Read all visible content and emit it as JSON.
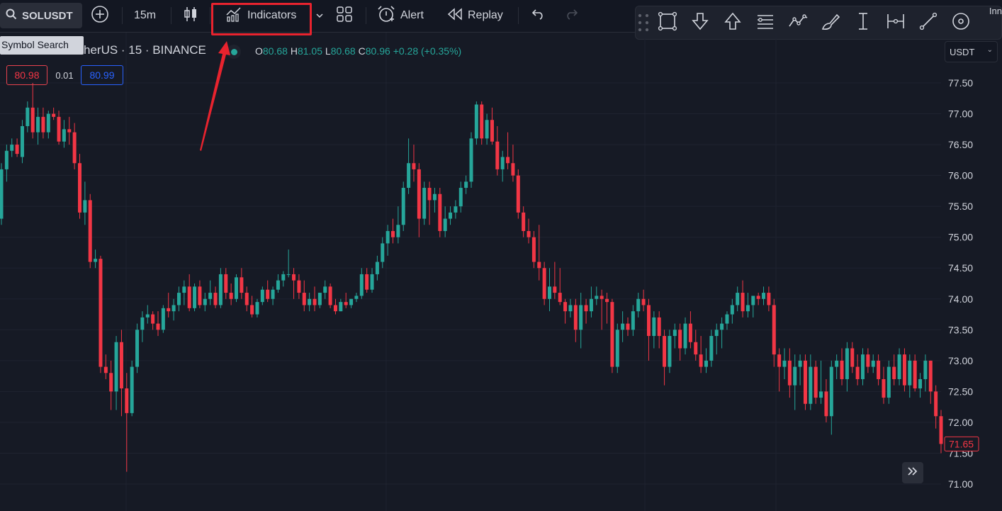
{
  "toolbar": {
    "symbol": "SOLUSDT",
    "interval": "15m",
    "indicators_label": "Indicators",
    "alert_label": "Alert",
    "replay_label": "Replay"
  },
  "tooltip": {
    "text": "Symbol Search"
  },
  "legend": {
    "symbol_text": "herUS · 15 · BINANCE",
    "o_key": "O",
    "o_val": "80.68",
    "h_key": "H",
    "h_val": "81.05",
    "l_key": "L",
    "l_val": "80.68",
    "c_key": "C",
    "c_val": "80.96",
    "change": "+0.28 (+0.35%)"
  },
  "order": {
    "sell": "80.98",
    "spread": "0.01",
    "buy": "80.99"
  },
  "currency": {
    "value": "USDT"
  },
  "drawbar": {
    "edge_text": "Inn"
  },
  "colors": {
    "up": "#26a69a",
    "down": "#f23645",
    "accent": "#2962ff",
    "highlight": "#e8232e"
  },
  "icons": [
    "search-icon",
    "plus-circle-icon",
    "candles-icon",
    "indicators-chart-icon",
    "chevron-down-icon",
    "layout-grid-icon",
    "alarm-icon",
    "replay-icon",
    "undo-icon",
    "redo-icon",
    "grip-icon",
    "rectangle-icon",
    "arrow-down-icon",
    "arrow-up-icon",
    "lines-icon",
    "wave-icon",
    "brush-icon",
    "text-cursor-icon",
    "measure-icon",
    "trend-line-icon",
    "eye-icon",
    "double-chevron-right-icon"
  ],
  "chart_data": {
    "type": "candlestick",
    "y_ticks": [
      "77.50",
      "77.00",
      "76.50",
      "76.00",
      "75.50",
      "75.00",
      "74.50",
      "74.00",
      "73.50",
      "73.00",
      "72.50",
      "72.00",
      "71.50",
      "71.00"
    ],
    "ylim": [
      70.95,
      77.9
    ],
    "last_price": "71.65",
    "grid": true,
    "candles": [
      [
        75.3,
        76.2,
        75.2,
        76.1
      ],
      [
        76.1,
        76.5,
        75.9,
        76.4
      ],
      [
        76.4,
        76.6,
        76.3,
        76.5
      ],
      [
        76.5,
        76.6,
        76.3,
        76.35
      ],
      [
        76.3,
        76.9,
        76.2,
        76.8
      ],
      [
        76.8,
        77.2,
        76.7,
        77.1
      ],
      [
        77.1,
        77.5,
        76.6,
        76.7
      ],
      [
        76.7,
        77.1,
        76.5,
        76.95
      ],
      [
        76.95,
        77.1,
        76.6,
        76.7
      ],
      [
        76.7,
        77.05,
        76.6,
        77.0
      ],
      [
        77.0,
        77.1,
        76.9,
        76.95
      ],
      [
        76.95,
        77.05,
        76.5,
        76.55
      ],
      [
        76.55,
        76.9,
        76.45,
        76.75
      ],
      [
        76.75,
        76.95,
        76.5,
        76.7
      ],
      [
        76.7,
        76.85,
        76.1,
        76.2
      ],
      [
        76.2,
        76.35,
        75.3,
        75.4
      ],
      [
        75.4,
        75.9,
        75.2,
        75.6
      ],
      [
        75.6,
        75.7,
        74.5,
        74.6
      ],
      [
        74.6,
        74.8,
        74.5,
        74.65
      ],
      [
        74.65,
        74.7,
        72.8,
        72.9
      ],
      [
        72.9,
        73.1,
        72.7,
        72.8
      ],
      [
        72.8,
        73.0,
        72.2,
        72.5
      ],
      [
        72.5,
        73.4,
        72.2,
        73.3
      ],
      [
        73.3,
        73.5,
        72.1,
        72.55
      ],
      [
        72.55,
        72.8,
        71.2,
        72.15
      ],
      [
        72.15,
        73.0,
        72.1,
        72.9
      ],
      [
        72.9,
        73.6,
        72.8,
        73.5
      ],
      [
        73.5,
        73.8,
        73.3,
        73.7
      ],
      [
        73.7,
        73.9,
        73.6,
        73.75
      ],
      [
        73.75,
        73.8,
        73.5,
        73.6
      ],
      [
        73.6,
        73.8,
        73.4,
        73.5
      ],
      [
        73.5,
        73.9,
        73.45,
        73.85
      ],
      [
        73.85,
        74.1,
        73.7,
        73.8
      ],
      [
        73.8,
        74.0,
        73.65,
        73.9
      ],
      [
        73.9,
        74.2,
        73.8,
        74.1
      ],
      [
        74.1,
        74.3,
        73.9,
        74.2
      ],
      [
        74.2,
        74.4,
        73.8,
        73.85
      ],
      [
        73.85,
        74.25,
        73.8,
        74.2
      ],
      [
        74.2,
        74.3,
        73.85,
        73.9
      ],
      [
        73.9,
        74.1,
        73.8,
        74.0
      ],
      [
        74.0,
        74.3,
        73.9,
        74.1
      ],
      [
        74.1,
        74.2,
        73.85,
        73.9
      ],
      [
        73.9,
        74.5,
        73.85,
        74.4
      ],
      [
        74.4,
        74.5,
        74.0,
        74.1
      ],
      [
        74.1,
        74.25,
        73.9,
        74.0
      ],
      [
        74.0,
        74.4,
        73.95,
        74.35
      ],
      [
        74.35,
        74.5,
        74.0,
        74.1
      ],
      [
        74.1,
        74.2,
        73.8,
        73.9
      ],
      [
        73.9,
        74.05,
        73.7,
        73.75
      ],
      [
        73.75,
        74.0,
        73.7,
        73.95
      ],
      [
        73.95,
        74.2,
        73.9,
        74.15
      ],
      [
        74.15,
        74.3,
        73.95,
        74.0
      ],
      [
        74.0,
        74.2,
        73.9,
        74.15
      ],
      [
        74.15,
        74.4,
        74.1,
        74.3
      ],
      [
        74.3,
        74.45,
        74.2,
        74.4
      ],
      [
        74.4,
        74.8,
        74.35,
        74.4
      ],
      [
        74.4,
        74.5,
        74.0,
        74.3
      ],
      [
        74.3,
        74.4,
        74.0,
        74.1
      ],
      [
        74.1,
        74.3,
        73.8,
        73.9
      ],
      [
        73.9,
        74.1,
        73.8,
        74.0
      ],
      [
        74.0,
        74.2,
        73.8,
        73.9
      ],
      [
        73.9,
        74.1,
        73.85,
        74.1
      ],
      [
        74.1,
        74.3,
        74.0,
        74.2
      ],
      [
        74.2,
        74.25,
        73.85,
        73.9
      ],
      [
        73.9,
        74.0,
        73.75,
        73.8
      ],
      [
        73.8,
        74.0,
        73.8,
        73.95
      ],
      [
        73.95,
        74.1,
        73.85,
        73.9
      ],
      [
        73.9,
        74.0,
        73.85,
        74.0
      ],
      [
        74.0,
        74.1,
        73.95,
        74.05
      ],
      [
        74.05,
        74.5,
        74.0,
        74.4
      ],
      [
        74.4,
        74.5,
        74.1,
        74.15
      ],
      [
        74.15,
        74.5,
        74.1,
        74.4
      ],
      [
        74.4,
        74.7,
        74.3,
        74.6
      ],
      [
        74.6,
        75.0,
        74.5,
        74.9
      ],
      [
        74.9,
        75.2,
        74.7,
        75.1
      ],
      [
        75.1,
        75.3,
        74.9,
        75.0
      ],
      [
        75.0,
        75.5,
        74.9,
        75.2
      ],
      [
        75.2,
        75.9,
        75.1,
        75.8
      ],
      [
        75.8,
        76.6,
        75.7,
        76.2
      ],
      [
        76.2,
        76.5,
        75.9,
        76.1
      ],
      [
        76.1,
        76.2,
        75.0,
        75.3
      ],
      [
        75.3,
        75.9,
        75.2,
        75.8
      ],
      [
        75.8,
        75.9,
        75.2,
        75.6
      ],
      [
        75.6,
        75.8,
        75.4,
        75.7
      ],
      [
        75.7,
        75.8,
        75.0,
        75.1
      ],
      [
        75.1,
        75.5,
        75.0,
        75.3
      ],
      [
        75.3,
        75.5,
        75.2,
        75.4
      ],
      [
        75.4,
        75.6,
        75.3,
        75.5
      ],
      [
        75.5,
        75.9,
        75.4,
        75.8
      ],
      [
        75.8,
        76.0,
        75.7,
        75.9
      ],
      [
        75.9,
        76.7,
        75.8,
        76.6
      ],
      [
        76.6,
        77.2,
        76.5,
        77.15
      ],
      [
        77.15,
        77.2,
        76.5,
        76.6
      ],
      [
        76.6,
        77.0,
        76.5,
        76.9
      ],
      [
        76.9,
        77.1,
        76.5,
        76.55
      ],
      [
        76.55,
        76.8,
        76.0,
        76.1
      ],
      [
        76.1,
        76.4,
        75.9,
        76.3
      ],
      [
        76.3,
        76.7,
        76.1,
        76.2
      ],
      [
        76.2,
        76.5,
        75.9,
        76.0
      ],
      [
        76.0,
        76.1,
        75.3,
        75.4
      ],
      [
        75.4,
        75.5,
        75.0,
        75.1
      ],
      [
        75.1,
        75.3,
        74.9,
        75.0
      ],
      [
        75.0,
        75.1,
        74.5,
        74.6
      ],
      [
        74.6,
        75.2,
        74.3,
        74.5
      ],
      [
        74.5,
        74.6,
        73.9,
        74.0
      ],
      [
        74.0,
        74.5,
        73.8,
        74.2
      ],
      [
        74.2,
        74.6,
        74.0,
        74.1
      ],
      [
        74.1,
        74.5,
        73.9,
        73.95
      ],
      [
        73.95,
        74.0,
        73.6,
        73.8
      ],
      [
        73.8,
        74.0,
        73.7,
        73.9
      ],
      [
        73.9,
        74.0,
        73.3,
        73.5
      ],
      [
        73.5,
        74.1,
        73.2,
        73.9
      ],
      [
        73.9,
        74.0,
        73.6,
        73.8
      ],
      [
        73.8,
        74.2,
        73.7,
        74.0
      ],
      [
        74.0,
        74.2,
        73.9,
        74.05
      ],
      [
        74.05,
        74.15,
        73.5,
        74.0
      ],
      [
        74.0,
        74.1,
        73.6,
        73.95
      ],
      [
        73.95,
        74.0,
        72.8,
        72.9
      ],
      [
        72.9,
        73.6,
        72.8,
        73.5
      ],
      [
        73.5,
        73.8,
        73.3,
        73.6
      ],
      [
        73.6,
        73.7,
        73.4,
        73.5
      ],
      [
        73.5,
        73.9,
        73.4,
        73.8
      ],
      [
        73.8,
        74.1,
        73.7,
        74.0
      ],
      [
        74.0,
        74.15,
        73.8,
        73.9
      ],
      [
        73.9,
        74.0,
        73.0,
        73.4
      ],
      [
        73.4,
        73.8,
        73.2,
        73.7
      ],
      [
        73.7,
        73.8,
        73.2,
        73.4
      ],
      [
        73.4,
        73.5,
        72.6,
        72.9
      ],
      [
        72.9,
        73.5,
        72.8,
        73.4
      ],
      [
        73.4,
        73.6,
        73.2,
        73.5
      ],
      [
        73.5,
        73.6,
        73.0,
        73.2
      ],
      [
        73.2,
        73.7,
        73.1,
        73.6
      ],
      [
        73.6,
        73.8,
        73.2,
        73.3
      ],
      [
        73.3,
        73.5,
        73.0,
        73.1
      ],
      [
        73.1,
        73.4,
        72.8,
        72.9
      ],
      [
        72.9,
        73.2,
        72.8,
        73.0
      ],
      [
        73.0,
        73.5,
        72.9,
        73.4
      ],
      [
        73.4,
        73.6,
        73.1,
        73.5
      ],
      [
        73.5,
        73.7,
        73.2,
        73.6
      ],
      [
        73.6,
        73.8,
        73.5,
        73.75
      ],
      [
        73.75,
        74.0,
        73.6,
        73.9
      ],
      [
        73.9,
        74.2,
        73.8,
        74.1
      ],
      [
        74.1,
        74.3,
        73.7,
        73.8
      ],
      [
        73.8,
        74.1,
        73.7,
        73.9
      ],
      [
        73.9,
        74.0,
        73.7,
        74.05
      ],
      [
        74.05,
        74.1,
        73.9,
        74.0
      ],
      [
        74.0,
        74.2,
        73.9,
        74.1
      ],
      [
        74.1,
        74.2,
        73.8,
        73.9
      ],
      [
        73.9,
        74.0,
        72.9,
        73.1
      ],
      [
        73.1,
        73.2,
        72.5,
        72.9
      ],
      [
        72.9,
        73.2,
        72.7,
        73.0
      ],
      [
        73.0,
        73.2,
        72.4,
        72.6
      ],
      [
        72.6,
        73.1,
        72.2,
        72.9
      ],
      [
        72.9,
        73.1,
        72.6,
        73.0
      ],
      [
        73.0,
        73.1,
        72.2,
        72.3
      ],
      [
        72.3,
        73.1,
        72.2,
        72.9
      ],
      [
        72.9,
        73.0,
        72.3,
        72.4
      ],
      [
        72.4,
        73.0,
        72.3,
        72.5
      ],
      [
        72.5,
        72.7,
        72.0,
        72.1
      ],
      [
        72.1,
        73.0,
        71.8,
        72.9
      ],
      [
        72.9,
        73.1,
        72.7,
        73.0
      ],
      [
        73.0,
        73.2,
        72.6,
        72.7
      ],
      [
        72.7,
        73.3,
        72.5,
        73.2
      ],
      [
        73.2,
        73.3,
        72.8,
        72.9
      ],
      [
        72.9,
        73.1,
        72.6,
        72.7
      ],
      [
        72.7,
        73.2,
        72.6,
        73.1
      ],
      [
        73.1,
        73.2,
        72.8,
        72.9
      ],
      [
        72.9,
        73.1,
        72.8,
        73.0
      ],
      [
        73.0,
        73.1,
        72.6,
        72.7
      ],
      [
        72.7,
        72.9,
        72.3,
        72.4
      ],
      [
        72.4,
        73.0,
        72.3,
        72.9
      ],
      [
        72.9,
        73.1,
        72.6,
        72.7
      ],
      [
        72.7,
        73.2,
        72.6,
        73.1
      ],
      [
        73.1,
        73.2,
        72.5,
        72.6
      ],
      [
        72.6,
        73.1,
        72.4,
        73.0
      ],
      [
        73.0,
        73.1,
        72.5,
        72.55
      ],
      [
        72.55,
        72.8,
        72.4,
        72.7
      ],
      [
        72.7,
        73.1,
        72.5,
        73.0
      ],
      [
        73.0,
        73.0,
        72.3,
        72.5
      ],
      [
        72.5,
        72.6,
        71.9,
        72.1
      ],
      [
        72.1,
        72.2,
        71.5,
        71.65
      ]
    ]
  }
}
